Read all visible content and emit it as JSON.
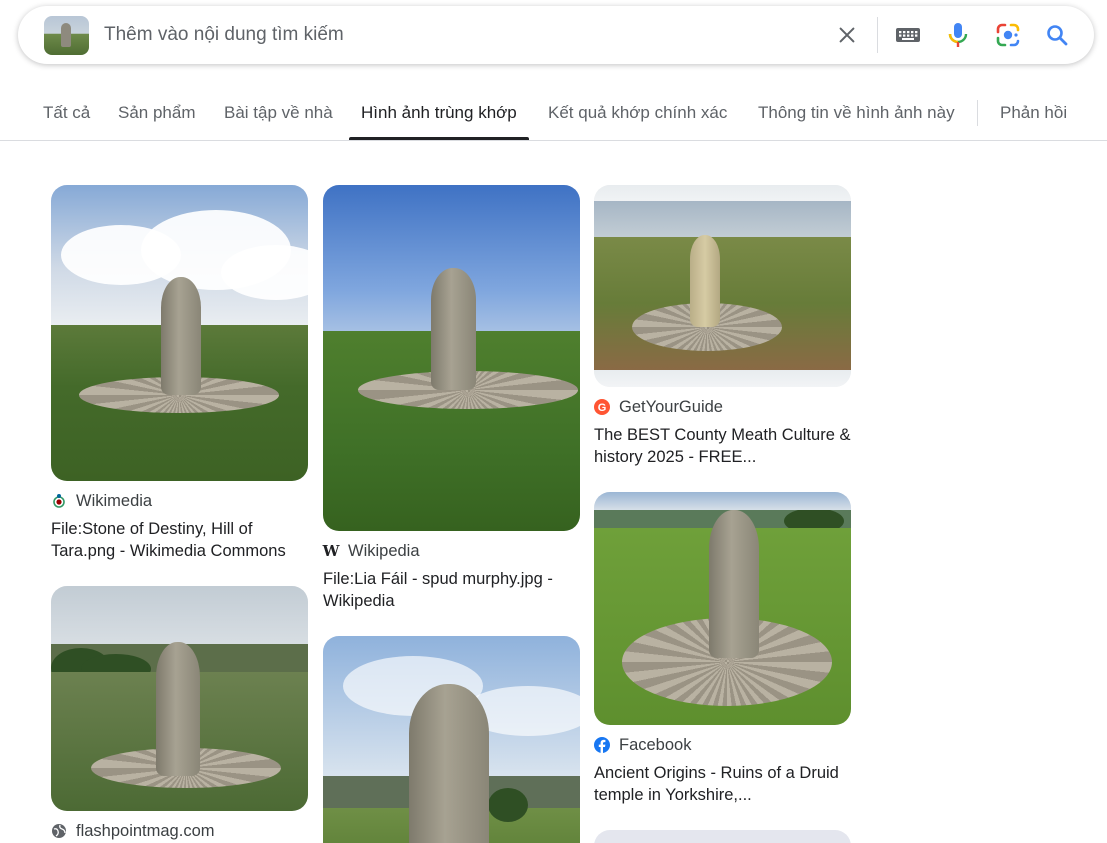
{
  "search": {
    "placeholder": "Thêm vào nội dung tìm kiếm",
    "value": ""
  },
  "tabs": [
    {
      "label": "Tất cả",
      "active": false
    },
    {
      "label": "Sản phẩm",
      "active": false
    },
    {
      "label": "Bài tập về nhà",
      "active": false
    },
    {
      "label": "Hình ảnh trùng khớp",
      "active": true
    },
    {
      "label": "Kết quả khớp chính xác",
      "active": false
    },
    {
      "label": "Thông tin về hình ảnh này",
      "active": false
    },
    {
      "label": "Phản hồi",
      "active": false
    }
  ],
  "results": [
    {
      "source": "Wikimedia",
      "favicon": "wikimedia-icon",
      "title": "File:Stone of Destiny, Hill of Tara.png - Wikimedia Commons"
    },
    {
      "source": "flashpointmag.com",
      "favicon": "globe-icon",
      "title": ""
    },
    {
      "source": "Wikipedia",
      "favicon": "wikipedia-icon",
      "title": "File:Lia Fáil - spud murphy.jpg - Wikipedia"
    },
    {
      "source": "",
      "favicon": "",
      "title": ""
    },
    {
      "source": "GetYourGuide",
      "favicon": "getyourguide-icon",
      "title": "The BEST County Meath Culture & history 2025 - FREE..."
    },
    {
      "source": "Facebook",
      "favicon": "facebook-icon",
      "title": "Ancient Origins - Ruins of a Druid temple in Yorkshire,..."
    }
  ],
  "colors": {
    "text_primary": "#202124",
    "text_secondary": "#5f6368",
    "google_blue": "#4285f4",
    "google_red": "#ea4335",
    "google_yellow": "#fbbc04",
    "google_green": "#34a853",
    "getyourguide": "#ff5533",
    "facebook": "#1877f2"
  }
}
